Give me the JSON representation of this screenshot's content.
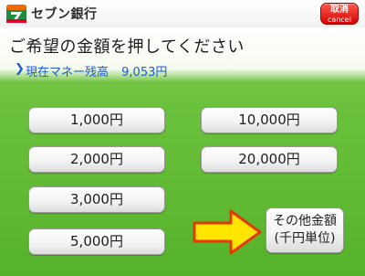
{
  "app": {
    "brand": "セブン銀行"
  },
  "topbar": {
    "cancel_label_jp": "取消",
    "cancel_label_en": "cancel"
  },
  "header": {
    "title": "ご希望の金額を押してください",
    "balance_label": "現在マネー残高",
    "balance_value": "9,053円"
  },
  "amounts": {
    "a1000": "1,000円",
    "a2000": "2,000円",
    "a3000": "3,000円",
    "a5000": "5,000円",
    "a10000": "10,000円",
    "a20000": "20,000円"
  },
  "other": {
    "line1": "その他金額",
    "line2": "(千円単位)"
  },
  "colors": {
    "background_green": "#6cc23e",
    "cancel_red": "#d50000",
    "balance_blue": "#1e5bd6",
    "arrow_yellow": "#ffe600",
    "arrow_outline": "#e23a00"
  },
  "icons": {
    "logo": "seven-bank-logo",
    "chevron": "chevron-right-icon",
    "arrow": "pointing-arrow-icon"
  }
}
